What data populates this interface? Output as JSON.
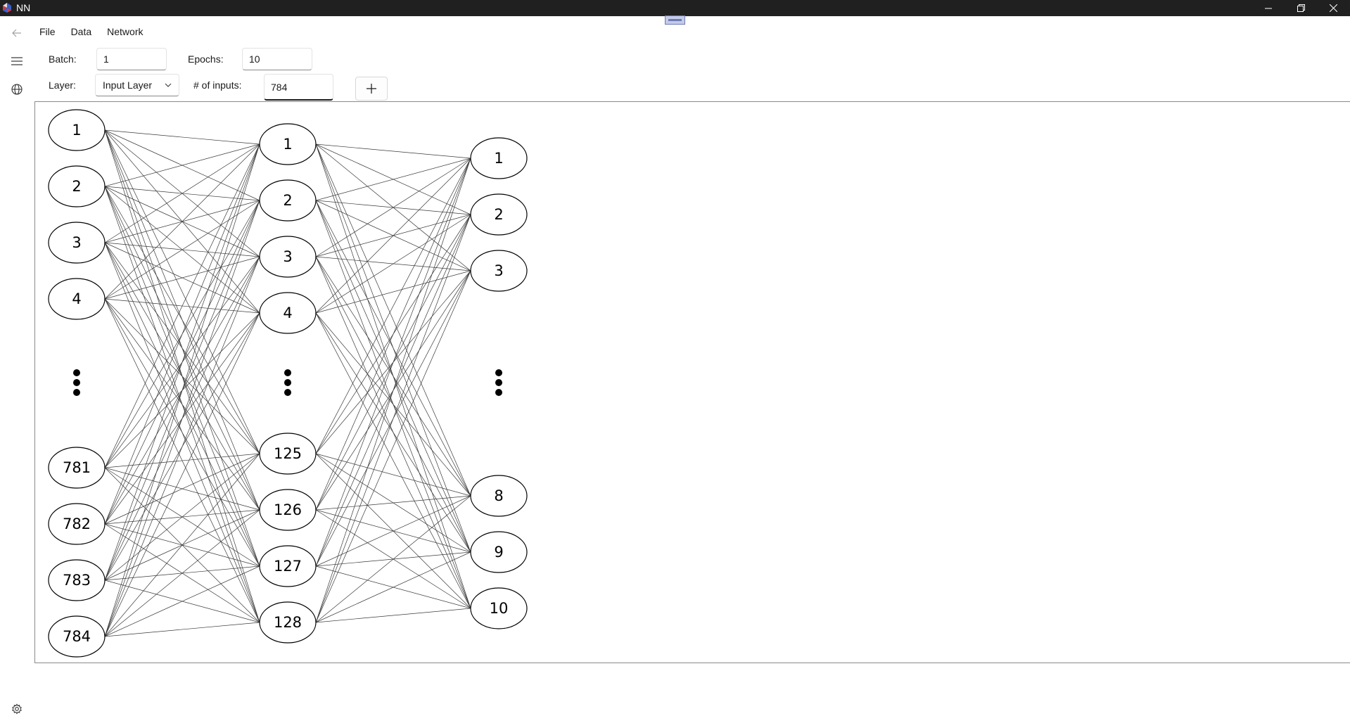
{
  "window": {
    "title": "NN"
  },
  "menu": {
    "items": [
      "File",
      "Data",
      "Network"
    ]
  },
  "rail": {
    "back_icon": "arrow-left-icon",
    "menu_icon": "hamburger-icon",
    "globe_icon": "globe-icon",
    "settings_icon": "gear-icon"
  },
  "controls": {
    "batch_label": "Batch:",
    "batch_value": "1",
    "epochs_label": "Epochs:",
    "epochs_value": "10",
    "layer_label": "Layer:",
    "layer_value": "Input Layer",
    "inputs_label": "# of inputs:",
    "inputs_value": "784",
    "add_label": "+"
  },
  "network": {
    "layers": [
      {
        "visible_top": [
          "1",
          "2",
          "3",
          "4"
        ],
        "visible_bottom": [
          "781",
          "782",
          "783",
          "784"
        ]
      },
      {
        "visible_top": [
          "1",
          "2",
          "3",
          "4"
        ],
        "visible_bottom": [
          "125",
          "126",
          "127",
          "128"
        ]
      },
      {
        "visible_top": [
          "1",
          "2",
          "3"
        ],
        "visible_bottom": [
          "8",
          "9",
          "10"
        ]
      }
    ],
    "fully_connected": true
  },
  "colors": {
    "titlebar": "#202020",
    "edge_stroke": "#3a3a3a",
    "node_stroke": "#000000",
    "accent": "#5a66b0"
  }
}
